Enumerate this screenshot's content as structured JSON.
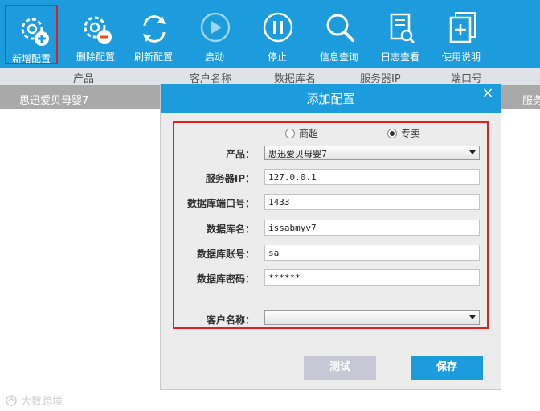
{
  "toolbar": {
    "buttons": [
      {
        "label": "新增配置",
        "icon": "gear-add-icon",
        "selected": true
      },
      {
        "label": "删除配置",
        "icon": "gear-remove-icon",
        "selected": false
      },
      {
        "label": "刷新配置",
        "icon": "refresh-icon",
        "selected": false
      },
      {
        "label": "启动",
        "icon": "play-icon",
        "selected": false
      },
      {
        "label": "停止",
        "icon": "pause-icon",
        "selected": false
      },
      {
        "label": "信息查询",
        "icon": "search-icon",
        "selected": false
      },
      {
        "label": "日志查看",
        "icon": "log-search-icon",
        "selected": false
      },
      {
        "label": "使用说明",
        "icon": "help-doc-icon",
        "selected": false
      }
    ]
  },
  "table": {
    "headers": [
      "产品",
      "客户名称",
      "数据库名",
      "服务器IP",
      "端口号"
    ],
    "rows": [
      {
        "product": "思迅爱贝母婴7",
        "right_cell": "服务"
      }
    ]
  },
  "dialog": {
    "title": "添加配置",
    "close_label": "×",
    "mode_options": [
      {
        "label": "商超",
        "checked": false
      },
      {
        "label": "专卖",
        "checked": true
      }
    ],
    "fields": {
      "product_label": "产品：",
      "product_value": "思迅爱贝母婴7",
      "server_ip_label": "服务器IP：",
      "server_ip_value": "127.0.0.1",
      "db_port_label": "数据库端口号：",
      "db_port_value": "1433",
      "db_name_label": "数据库名：",
      "db_name_value": "issabmyv7",
      "db_account_label": "数据库账号：",
      "db_account_value": "sa",
      "db_password_label": "数据库密码：",
      "db_password_value": "******",
      "customer_label": "客户名称：",
      "customer_value": ""
    },
    "test_button": "测试",
    "save_button": "保存"
  },
  "watermark": {
    "text": "大数跨境"
  },
  "colors": {
    "accent": "#1c9bdd",
    "highlight": "#e02020",
    "row_gray": "#a9a9a9",
    "header_gray": "#dfe3e8"
  }
}
